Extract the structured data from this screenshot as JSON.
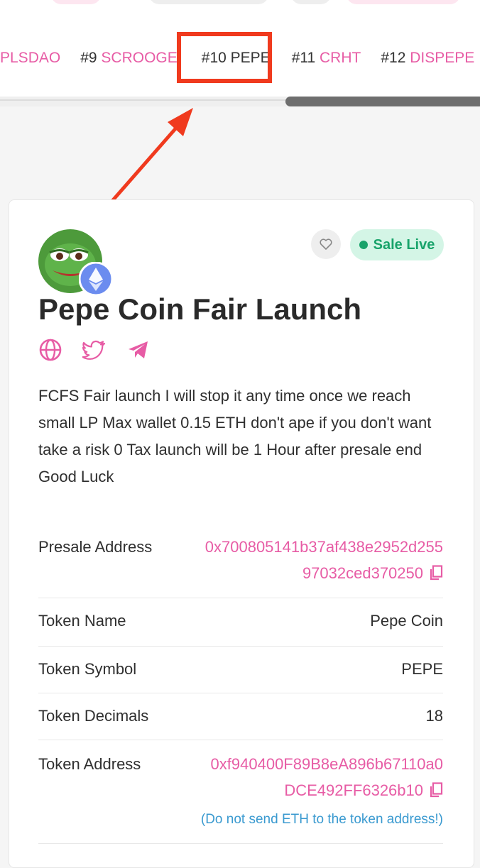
{
  "ticker": {
    "items": [
      {
        "rank": "",
        "symbol": "PLSDAO"
      },
      {
        "rank": "#9",
        "symbol": "SCROOGE"
      },
      {
        "rank": "#10",
        "symbol": "PEPE"
      },
      {
        "rank": "#11",
        "symbol": "CRHT"
      },
      {
        "rank": "#12",
        "symbol": "DISPEPE"
      }
    ]
  },
  "card": {
    "title": "Pepe Coin Fair Launch",
    "status": "Sale Live",
    "description": "FCFS Fair launch I will stop it any time once we reach small LP Max wallet 0.15 ETH don't ape if you don't want take a risk 0 Tax launch will be 1 Hour after presale end Good Luck",
    "details": {
      "presale_address": {
        "label": "Presale Address",
        "line1": "0x700805141b37af438e2952d255",
        "line2": "97032ced370250"
      },
      "token_name": {
        "label": "Token Name",
        "value": "Pepe Coin"
      },
      "token_symbol": {
        "label": "Token Symbol",
        "value": "PEPE"
      },
      "token_decimals": {
        "label": "Token Decimals",
        "value": "18"
      },
      "token_address": {
        "label": "Token Address",
        "line1": "0xf940400F89B8eA896b67110a0",
        "line2": "DCE492FF6326b10",
        "note": "(Do not send ETH to the token address!)"
      }
    }
  },
  "colors": {
    "accent_pink": "#e75ca5",
    "sale_green": "#18a36a",
    "highlight_red": "#f03a1e",
    "note_blue": "#3a9ad0"
  }
}
